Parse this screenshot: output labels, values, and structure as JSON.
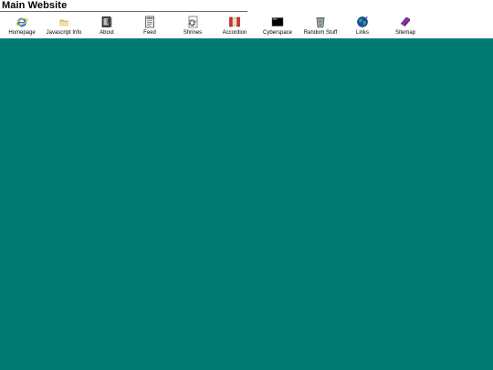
{
  "header": {
    "title": "Main Website"
  },
  "nav": [
    {
      "label": "Homepage",
      "icon": "internet-explorer-icon"
    },
    {
      "label": "Javascript Info",
      "icon": "folder-icon"
    },
    {
      "label": "About",
      "icon": "about-book-icon"
    },
    {
      "label": "Feed",
      "icon": "document-icon"
    },
    {
      "label": "Shrines",
      "icon": "shrine-page-icon"
    },
    {
      "label": "Accordion",
      "icon": "accordion-icon"
    },
    {
      "label": "Cyberspace",
      "icon": "terminal-icon"
    },
    {
      "label": "Random Stuff",
      "icon": "recycle-bin-icon"
    },
    {
      "label": "Links",
      "icon": "globe-icon"
    },
    {
      "label": "Sitemap",
      "icon": "purple-book-icon"
    }
  ],
  "colors": {
    "desktop_background": "#007b73",
    "header_background": "#ffffff"
  }
}
